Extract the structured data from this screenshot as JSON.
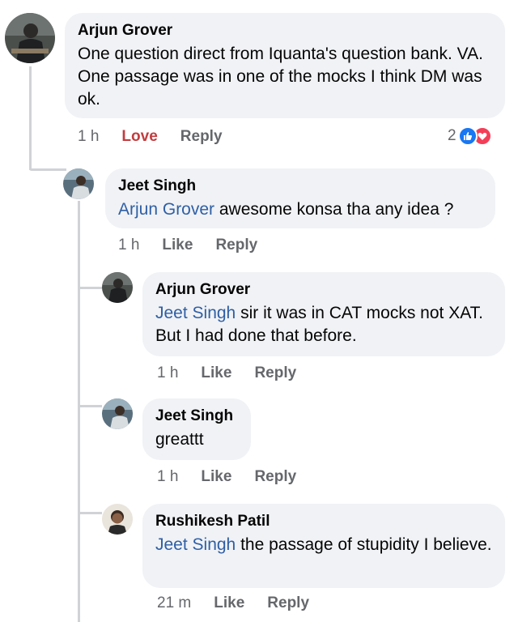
{
  "comments": [
    {
      "author": "Arjun Grover",
      "text": "One question direct from Iquanta's question bank. VA. One passage was in one of the mocks I think DM was ok.",
      "time": "1 h",
      "action_love": "Love",
      "action_reply": "Reply",
      "reaction_count": "2"
    },
    {
      "author": "Jeet Singh",
      "mention": "Arjun Grover",
      "text": " awesome konsa tha any idea ?",
      "time": "1 h",
      "action_like": "Like",
      "action_reply": "Reply"
    },
    {
      "author": "Arjun Grover",
      "mention": "Jeet Singh",
      "text": " sir it was in CAT mocks not XAT. But I had done that before.",
      "time": "1 h",
      "action_like": "Like",
      "action_reply": "Reply"
    },
    {
      "author": "Jeet Singh",
      "text": "greattt",
      "time": "1 h",
      "action_like": "Like",
      "action_reply": "Reply"
    },
    {
      "author": "Rushikesh Patil",
      "mention": "Jeet Singh",
      "text": " the passage of stupidity I believe.",
      "time": "21 m",
      "action_like": "Like",
      "action_reply": "Reply"
    }
  ],
  "colors": {
    "bubble": "#f0f2f5",
    "mention": "#2f5fa5",
    "love": "#c33c3f",
    "like_blue": "#1877f2",
    "heart_red": "#f33e58"
  }
}
